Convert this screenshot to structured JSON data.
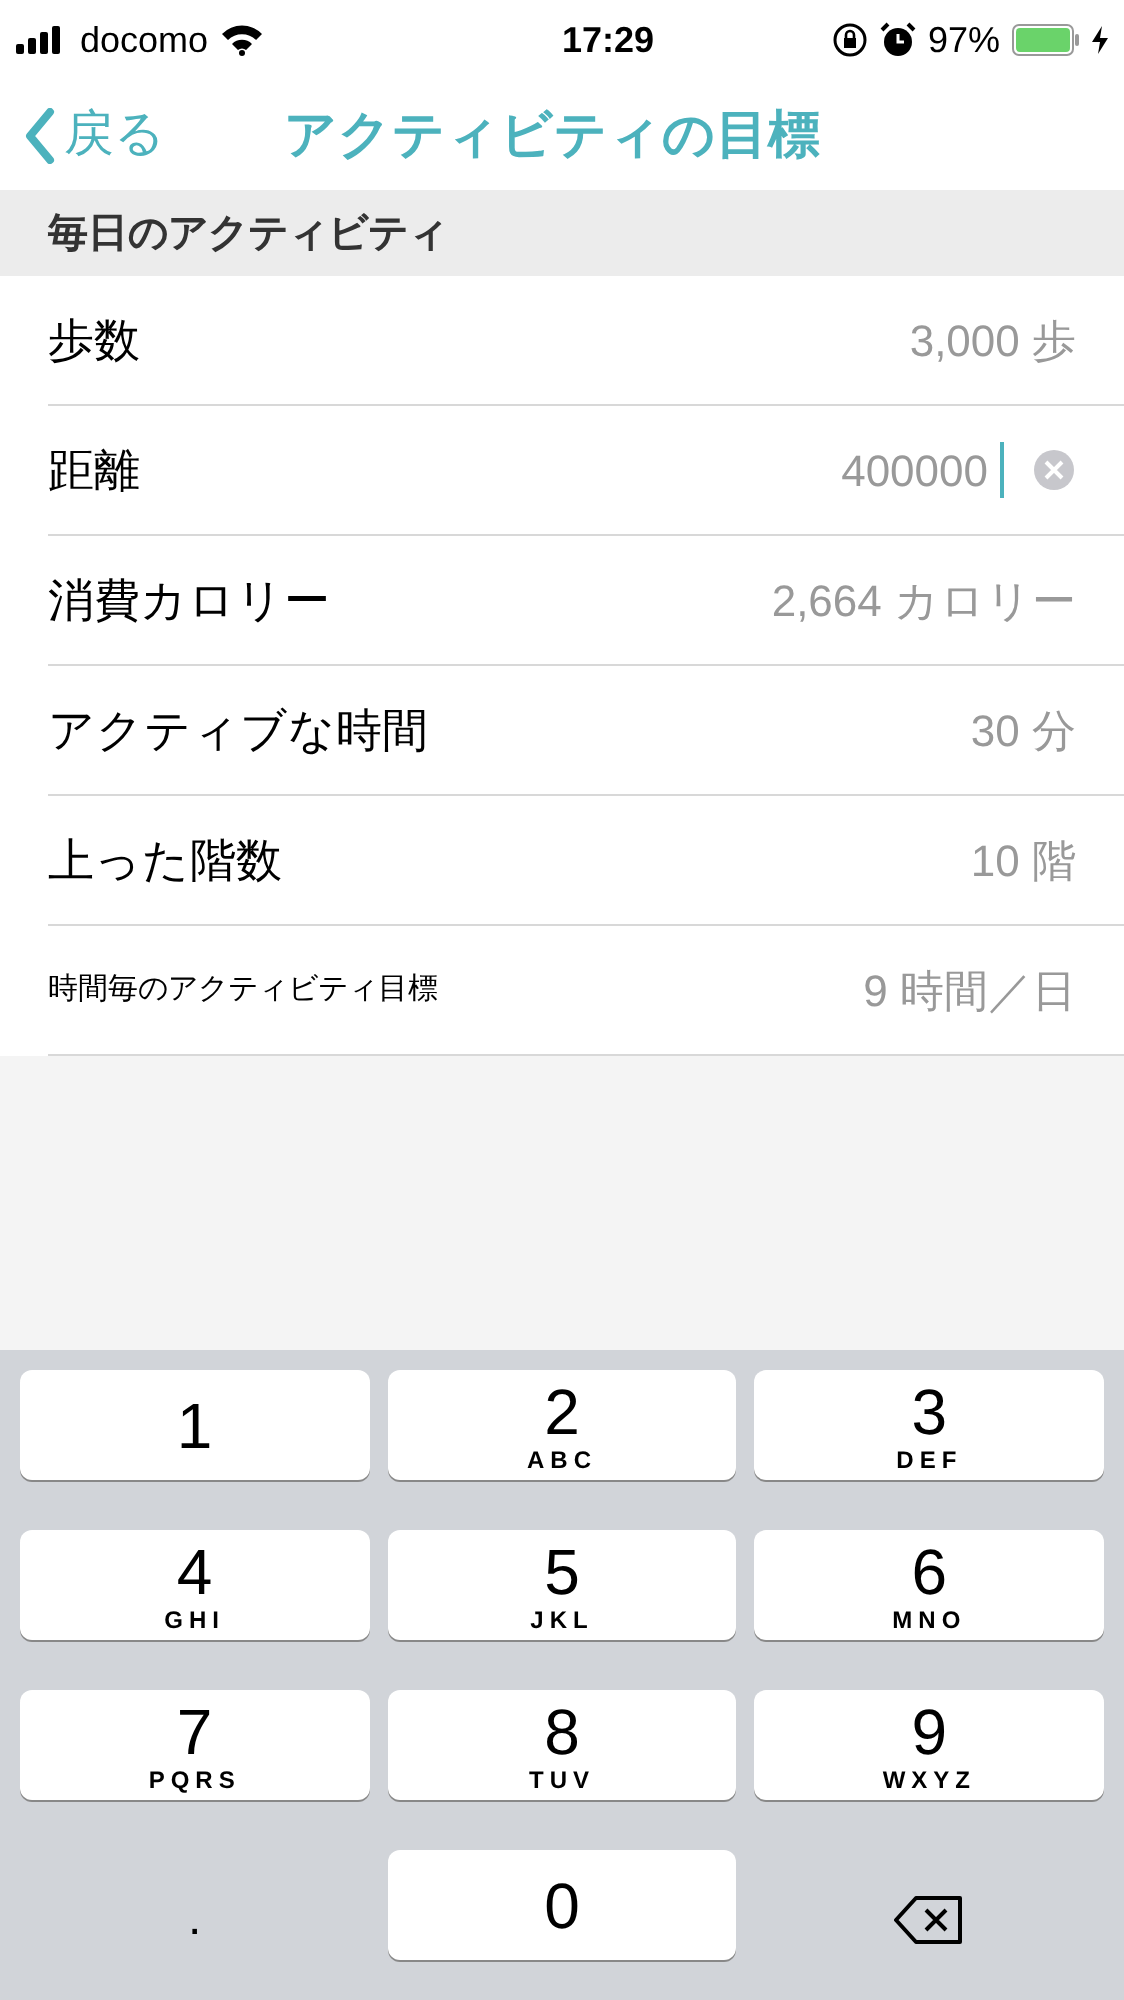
{
  "status_bar": {
    "carrier": "docomo",
    "time": "17:29",
    "battery": "97%"
  },
  "nav": {
    "back": "戻る",
    "title": "アクティビティの目標"
  },
  "section": {
    "title": "毎日のアクティビティ"
  },
  "rows": [
    {
      "kind": "value",
      "label": "歩数",
      "value": "3,000 歩"
    },
    {
      "kind": "field",
      "label": "距離",
      "value": "400000"
    },
    {
      "kind": "value",
      "label": "消費カロリー",
      "value": "2,664 カロリー"
    },
    {
      "kind": "value",
      "label": "アクティブな時間",
      "value": "30 分"
    },
    {
      "kind": "value",
      "label": "上った階数",
      "value": "10 階"
    },
    {
      "kind": "small",
      "label": "時間毎のアクティビティ目標",
      "value": "9 時間／日"
    }
  ],
  "keypad": [
    {
      "kind": "key",
      "digit": "1"
    },
    {
      "kind": "key",
      "digit": "2",
      "letters": "ABC"
    },
    {
      "kind": "key",
      "digit": "3",
      "letters": "DEF"
    },
    {
      "kind": "key",
      "digit": "4",
      "letters": "GHI"
    },
    {
      "kind": "key",
      "digit": "5",
      "letters": "JKL"
    },
    {
      "kind": "key",
      "digit": "6",
      "letters": "MNO"
    },
    {
      "kind": "key",
      "digit": "7",
      "letters": "PQRS"
    },
    {
      "kind": "key",
      "digit": "8",
      "letters": "TUV"
    },
    {
      "kind": "key",
      "digit": "9",
      "letters": "WXYZ"
    },
    {
      "kind": "plain",
      "digit": "."
    },
    {
      "kind": "key",
      "digit": "0"
    },
    {
      "kind": "delete"
    }
  ]
}
